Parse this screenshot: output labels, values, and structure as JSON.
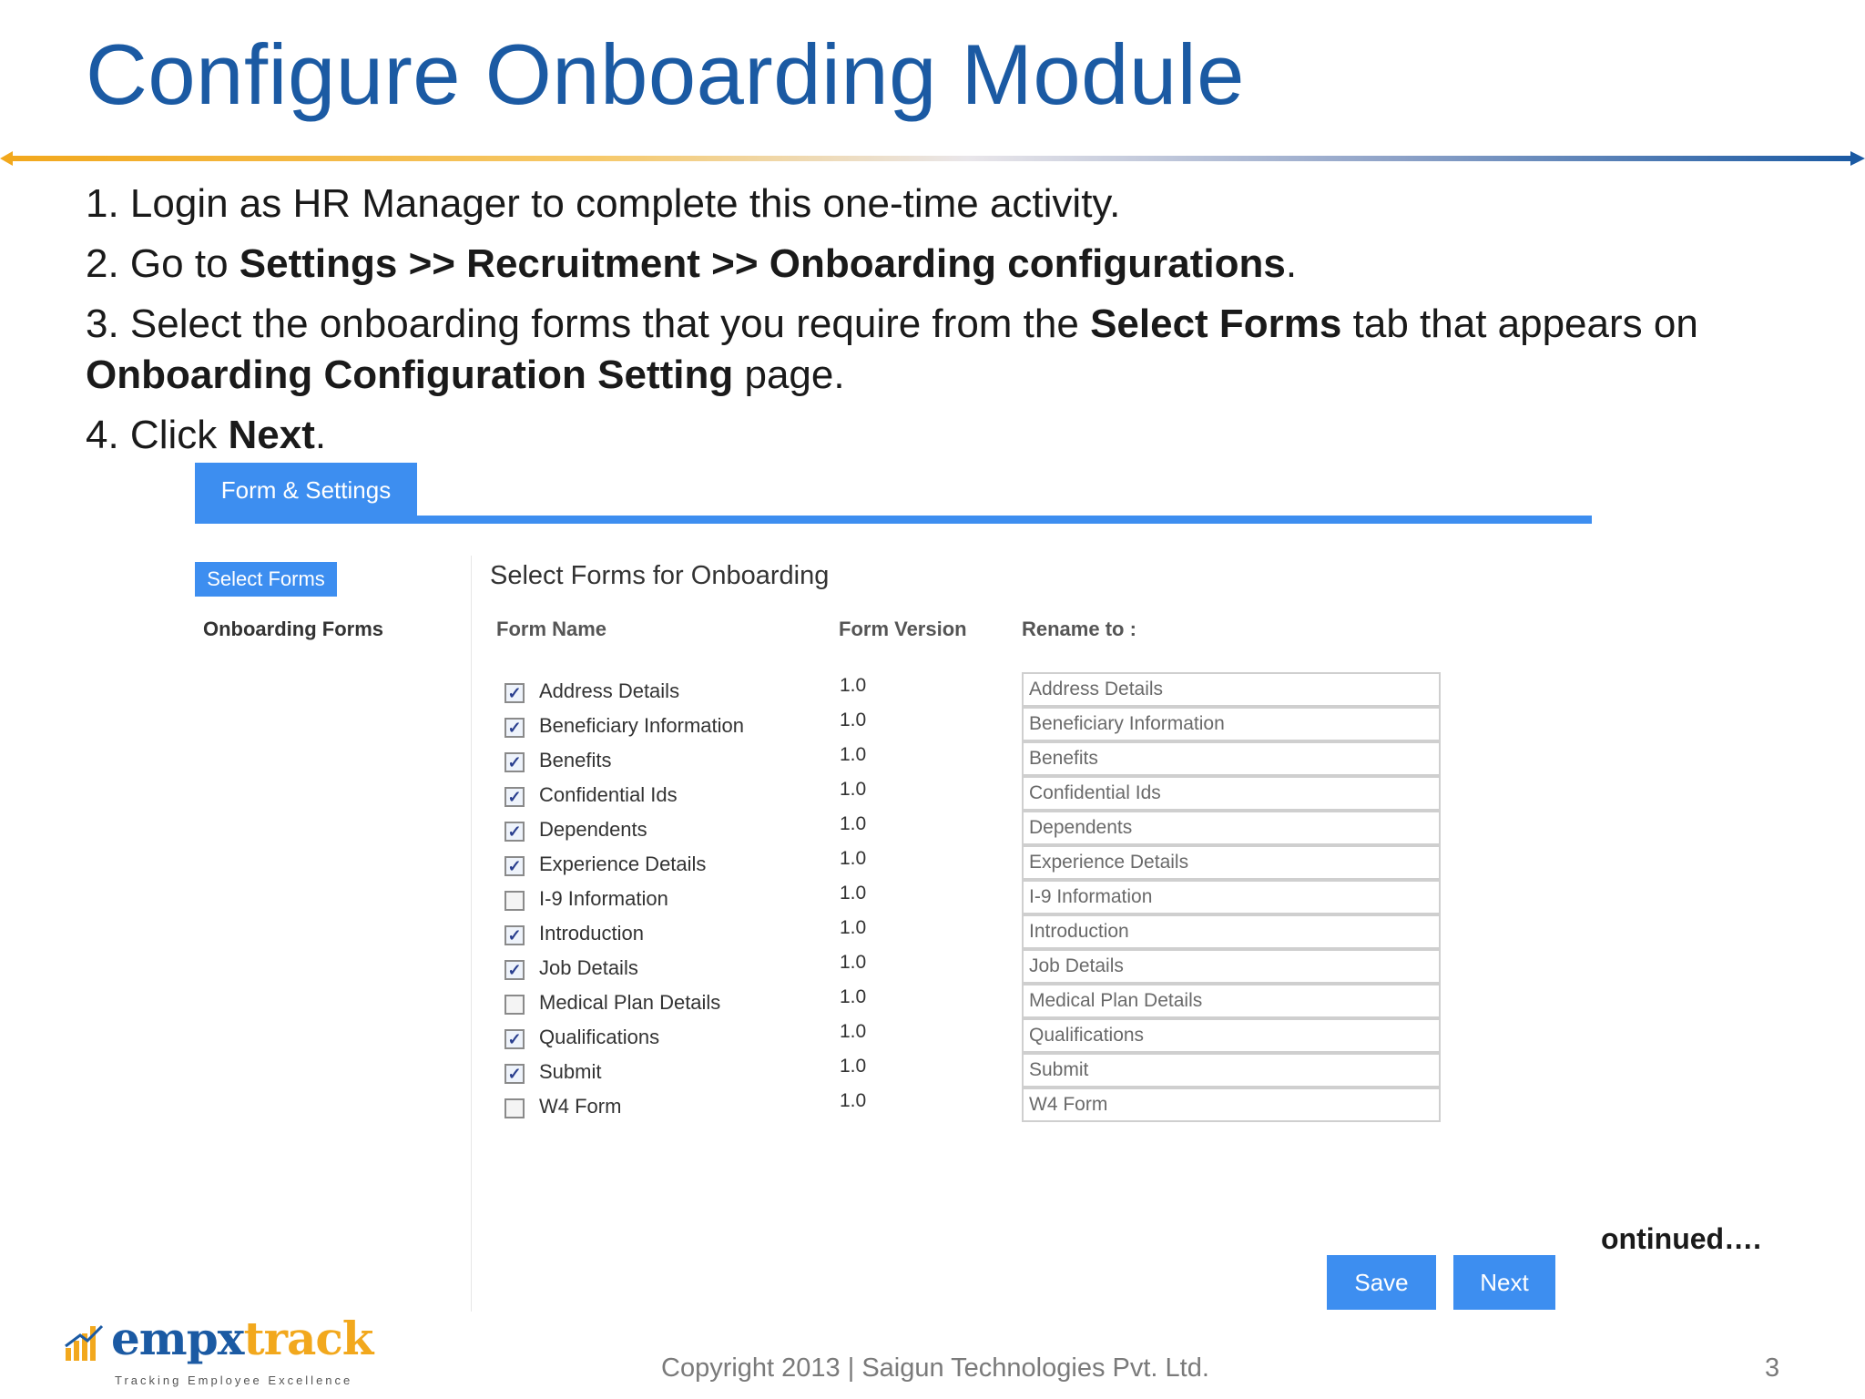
{
  "slide": {
    "title": "Configure Onboarding Module",
    "steps": [
      {
        "prefix": "1. Login as HR Manager to complete this one-time activity.",
        "bold1": "",
        "mid": "",
        "bold2": "",
        "suffix": ""
      },
      {
        "prefix": "2. Go to ",
        "bold1": "Settings >> Recruitment >> Onboarding configurations",
        "mid": ".",
        "bold2": "",
        "suffix": ""
      },
      {
        "prefix": "3. Select the onboarding forms that you require from the ",
        "bold1": "Select Forms",
        "mid": " tab that appears on ",
        "bold2": "Onboarding Configuration Setting",
        "suffix": " page."
      },
      {
        "prefix": "4. Click ",
        "bold1": "Next",
        "mid": ".",
        "bold2": "",
        "suffix": ""
      }
    ],
    "continued": "ontinued….",
    "copyright": "Copyright 2013 | Saigun Technologies Pvt. Ltd.",
    "page_number": "3"
  },
  "logo": {
    "word_part1": "empx",
    "word_part2": "track",
    "tagline": "Tracking Employee Excellence"
  },
  "app": {
    "tab_active": "Form & Settings",
    "sidebar": {
      "active": "Select Forms",
      "item": "Onboarding Forms"
    },
    "section_title": "Select Forms for Onboarding",
    "columns": {
      "name": "Form Name",
      "version": "Form Version",
      "rename": "Rename to :"
    },
    "forms": [
      {
        "name": "Address Details",
        "version": "1.0",
        "rename": "Address Details",
        "checked": true
      },
      {
        "name": "Beneficiary Information",
        "version": "1.0",
        "rename": "Beneficiary Information",
        "checked": true
      },
      {
        "name": "Benefits",
        "version": "1.0",
        "rename": "Benefits",
        "checked": true
      },
      {
        "name": "Confidential Ids",
        "version": "1.0",
        "rename": "Confidential Ids",
        "checked": true
      },
      {
        "name": "Dependents",
        "version": "1.0",
        "rename": "Dependents",
        "checked": true
      },
      {
        "name": "Experience Details",
        "version": "1.0",
        "rename": "Experience Details",
        "checked": true
      },
      {
        "name": "I-9 Information",
        "version": "1.0",
        "rename": "I-9 Information",
        "checked": false
      },
      {
        "name": "Introduction",
        "version": "1.0",
        "rename": "Introduction",
        "checked": true
      },
      {
        "name": "Job Details",
        "version": "1.0",
        "rename": "Job Details",
        "checked": true
      },
      {
        "name": "Medical Plan Details",
        "version": "1.0",
        "rename": "Medical Plan Details",
        "checked": false
      },
      {
        "name": "Qualifications",
        "version": "1.0",
        "rename": "Qualifications",
        "checked": true
      },
      {
        "name": "Submit",
        "version": "1.0",
        "rename": "Submit",
        "checked": true
      },
      {
        "name": "W4 Form",
        "version": "1.0",
        "rename": "W4 Form",
        "checked": false
      }
    ],
    "buttons": {
      "save": "Save",
      "next": "Next"
    },
    "colors": {
      "accent": "#3d8ef0",
      "title": "#1b5aa3",
      "divider_left": "#f2a81d",
      "divider_right": "#1b5aa3"
    },
    "icons": {
      "checkbox_checked": "check-icon"
    }
  }
}
